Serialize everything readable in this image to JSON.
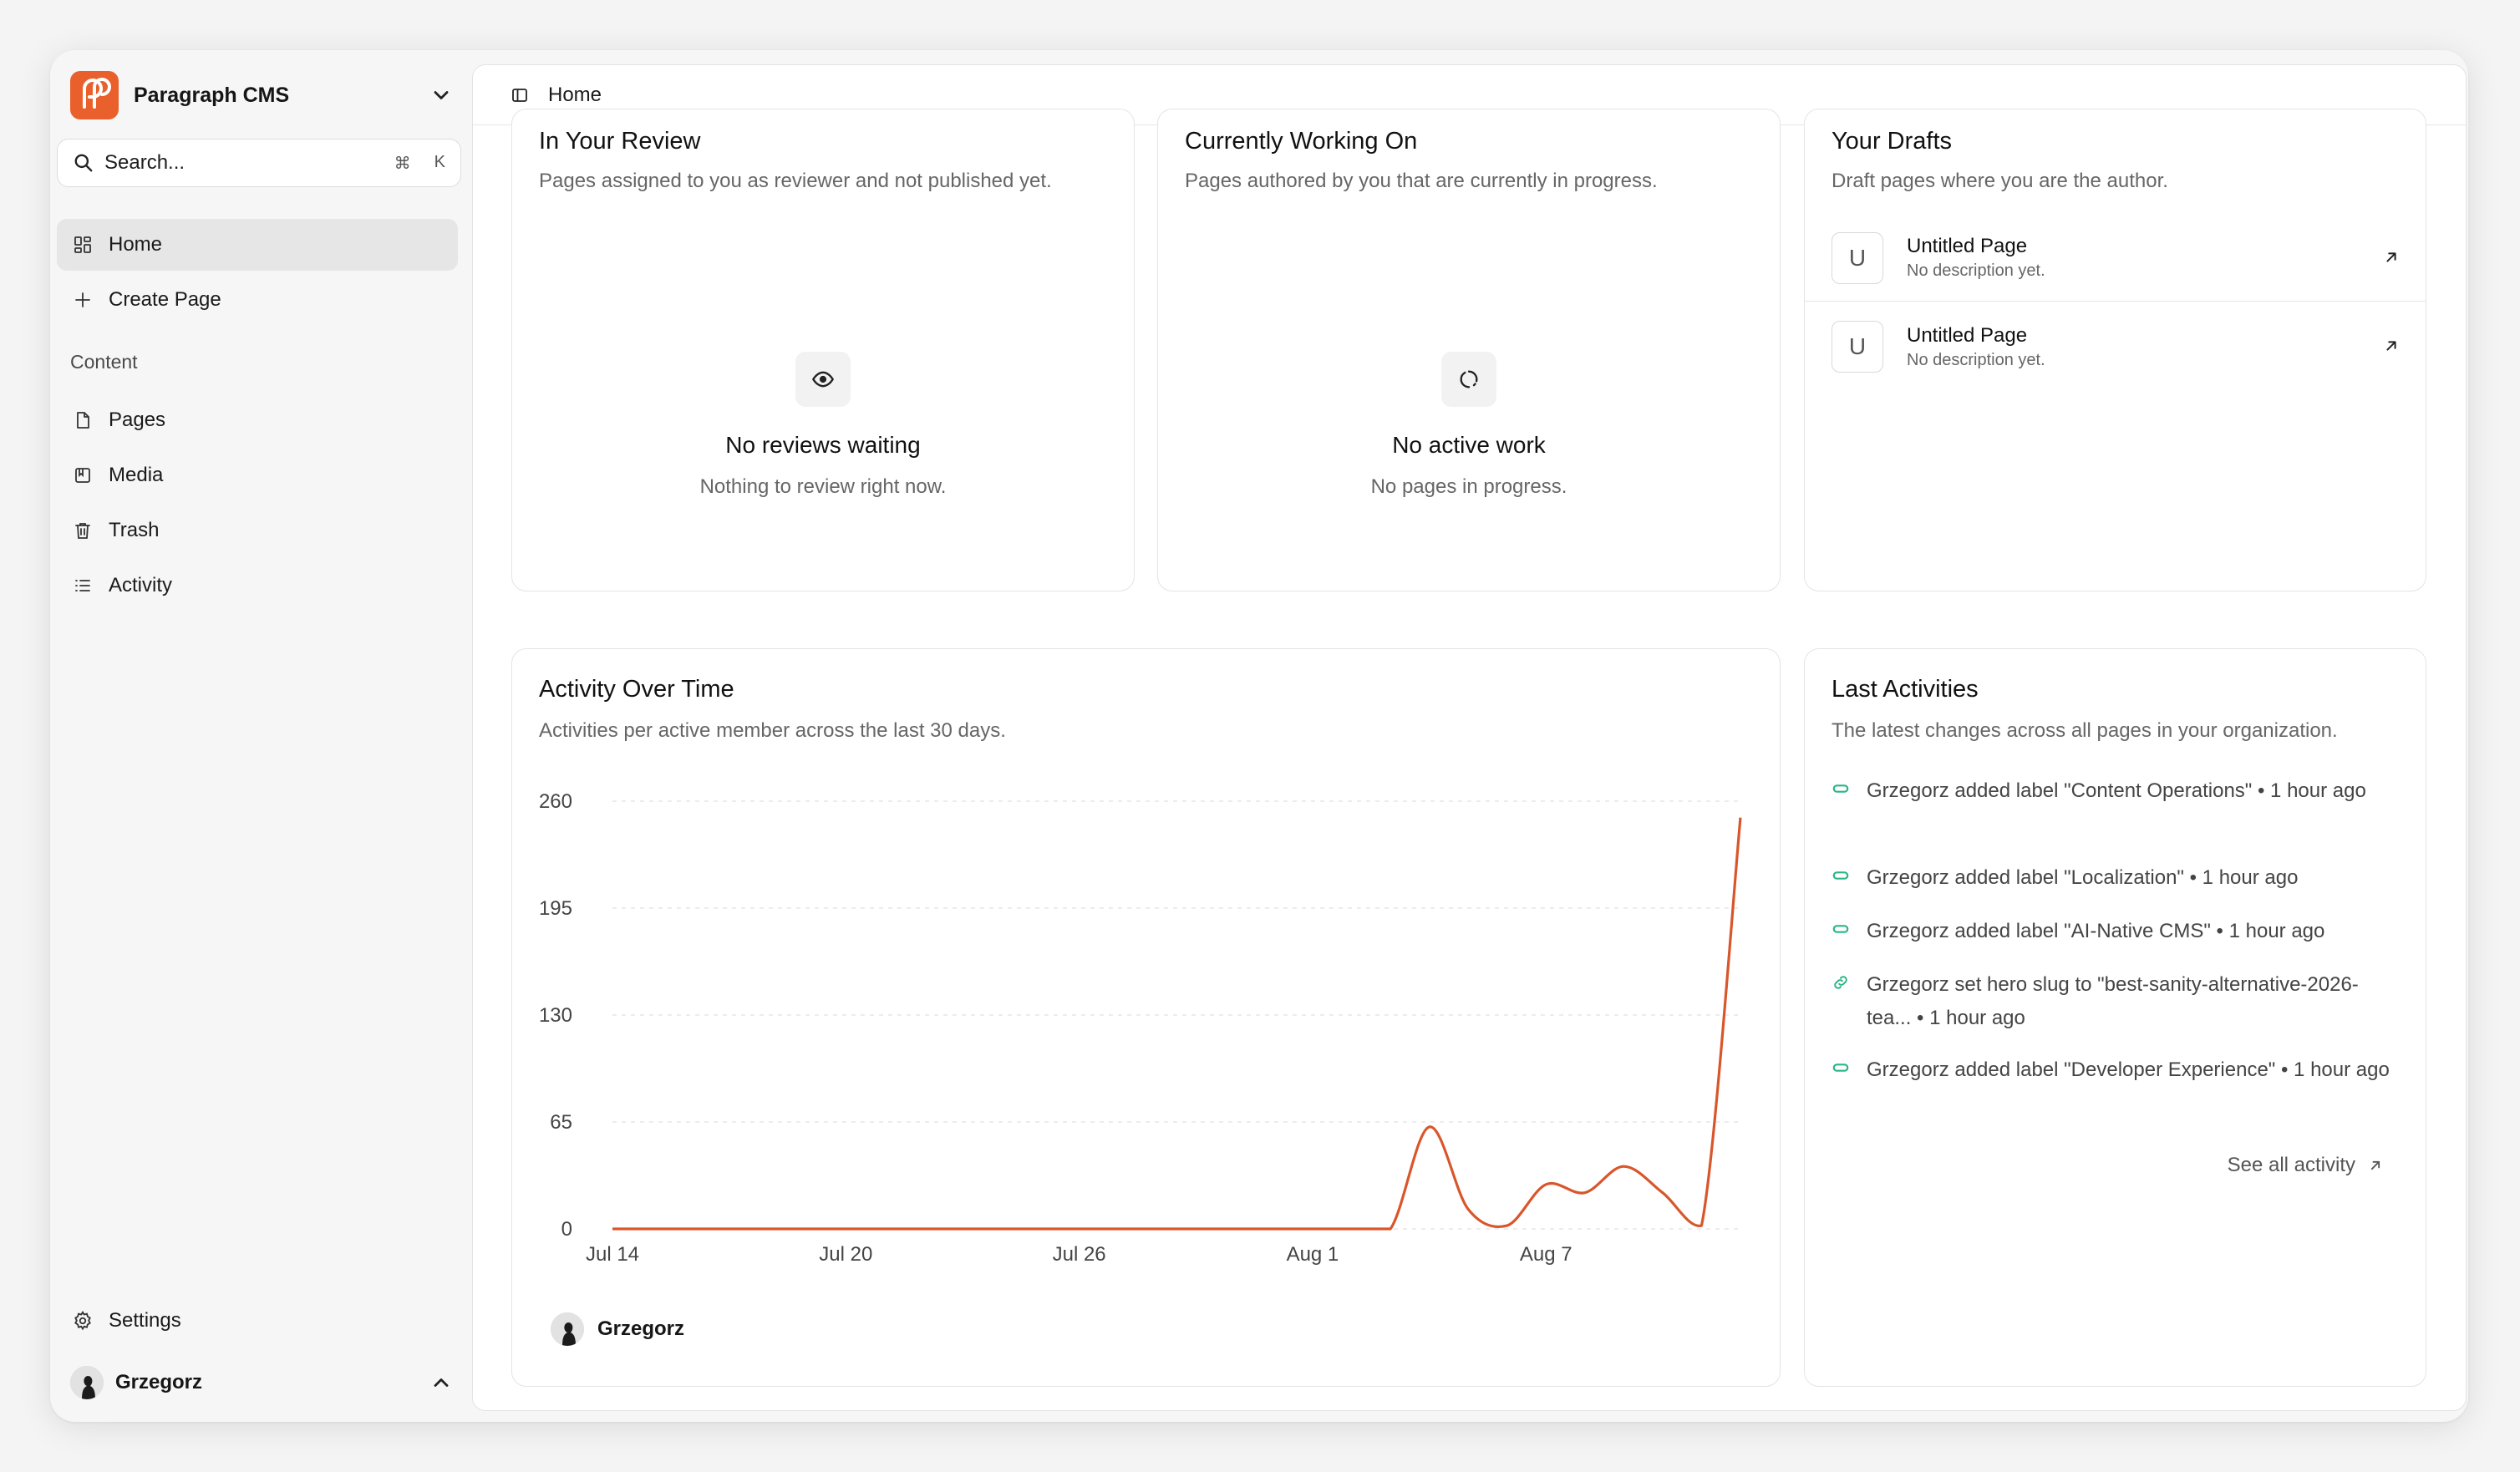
{
  "sidebar": {
    "brand_name": "Paragraph CMS",
    "search_label": "Search...",
    "search_kbd_1": "⌘",
    "search_kbd_2": "K",
    "home": "Home",
    "create_page": "Create Page",
    "section_content": "Content",
    "pages": "Pages",
    "media": "Media",
    "trash": "Trash",
    "activity": "Activity",
    "settings": "Settings",
    "user_name": "Grzegorz"
  },
  "topbar": {
    "title": "Home"
  },
  "review": {
    "title": "In Your Review",
    "desc": "Pages assigned to you as reviewer and not published yet.",
    "empty_title": "No reviews waiting",
    "empty_sub": "Nothing to review right now."
  },
  "working": {
    "title": "Currently Working On",
    "desc": "Pages authored by you that are currently in progress.",
    "empty_title": "No active work",
    "empty_sub": "No pages in progress."
  },
  "drafts": {
    "title": "Your Drafts",
    "desc": "Draft pages where you are the author.",
    "items": [
      {
        "badge": "U",
        "title": "Untitled Page",
        "sub": "No description yet."
      },
      {
        "badge": "U",
        "title": "Untitled Page",
        "sub": "No description yet."
      }
    ]
  },
  "activity_chart": {
    "title": "Activity Over Time",
    "desc": "Activities per active member across the last 30 days.",
    "legend_name": "Grzegorz",
    "line_color": "#d9562b"
  },
  "chart_data": {
    "type": "line",
    "x": [
      "Jul 14",
      "Jul 15",
      "Jul 16",
      "Jul 17",
      "Jul 18",
      "Jul 19",
      "Jul 20",
      "Jul 21",
      "Jul 22",
      "Jul 23",
      "Jul 24",
      "Jul 25",
      "Jul 26",
      "Jul 27",
      "Jul 28",
      "Jul 29",
      "Jul 30",
      "Jul 31",
      "Aug 1",
      "Aug 2",
      "Aug 3",
      "Aug 4",
      "Aug 5",
      "Aug 6",
      "Aug 7",
      "Aug 8",
      "Aug 9",
      "Aug 10",
      "Aug 11",
      "Aug 12"
    ],
    "x_ticks": [
      "Jul 14",
      "Jul 20",
      "Jul 26",
      "Aug 1",
      "Aug 7"
    ],
    "y_ticks": [
      0,
      65,
      130,
      195,
      260
    ],
    "ylim": [
      0,
      260
    ],
    "grid": true,
    "series": [
      {
        "name": "Grzegorz",
        "values": [
          0,
          0,
          0,
          0,
          0,
          0,
          0,
          0,
          0,
          0,
          0,
          0,
          0,
          0,
          0,
          0,
          0,
          0,
          0,
          0,
          0,
          62,
          12,
          2,
          27,
          22,
          38,
          22,
          2,
          250
        ]
      }
    ]
  },
  "last_activities": {
    "title": "Last Activities",
    "desc": "The latest changes across all pages in your organization.",
    "items": [
      {
        "text": "Grzegorz added label \"Content Operations\" • 1 hour ago",
        "icon": "label-icon"
      },
      {
        "text": "Grzegorz added label \"Localization\" • 1 hour ago",
        "icon": "label-icon"
      },
      {
        "text": "Grzegorz added label \"AI-Native CMS\" • 1 hour ago",
        "icon": "label-icon"
      },
      {
        "text": "Grzegorz set hero slug to \"best-sanity-alternative-2026-tea... • 1 hour ago",
        "icon": "link-icon"
      },
      {
        "text": "Grzegorz added label \"Developer Experience\" • 1 hour ago",
        "icon": "label-icon"
      }
    ],
    "see_all": "See all activity",
    "accent": "#2bb58a"
  }
}
